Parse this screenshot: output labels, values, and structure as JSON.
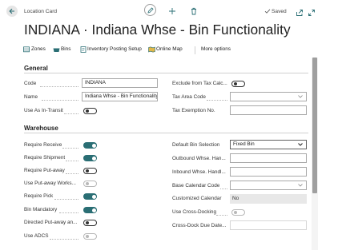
{
  "header": {
    "card_type": "Location Card",
    "saved": "Saved",
    "title": "INDIANA · Indiana Whse - Bin Functionality"
  },
  "actions": {
    "zones": "Zones",
    "bins": "Bins",
    "inventory_posting_setup": "Inventory Posting Setup",
    "online_map": "Online Map",
    "more_options": "More options"
  },
  "general": {
    "title": "General",
    "code_label": "Code",
    "code_value": "INDIANA",
    "name_label": "Name",
    "name_value": "Indiana Whse - Bin Functionality",
    "use_as_in_transit_label": "Use As In-Transit",
    "use_as_in_transit": false,
    "exclude_tax_label": "Exclude from Tax Calc...",
    "exclude_tax": false,
    "tax_area_code_label": "Tax Area Code",
    "tax_area_code_value": "",
    "tax_exemption_label": "Tax Exemption No.",
    "tax_exemption_value": ""
  },
  "warehouse": {
    "title": "Warehouse",
    "require_receive_label": "Require Receive",
    "require_receive": true,
    "require_shipment_label": "Require Shipment",
    "require_shipment": true,
    "require_putaway_label": "Require Put-away",
    "require_putaway": false,
    "use_putaway_worksheet_label": "Use Put-away Works...",
    "use_putaway_worksheet": false,
    "require_pick_label": "Require Pick",
    "require_pick": true,
    "bin_mandatory_label": "Bin Mandatory",
    "bin_mandatory": true,
    "directed_putaway_label": "Directed Put-away an...",
    "directed_putaway": false,
    "use_adcs_label": "Use ADCS",
    "use_adcs": false,
    "default_bin_selection_label": "Default Bin Selection",
    "default_bin_selection_value": "Fixed Bin",
    "outbound_whse_label": "Outbound Whse. Han...",
    "outbound_whse_value": "",
    "inbound_whse_label": "Inbound Whse. Handl...",
    "inbound_whse_value": "",
    "base_calendar_label": "Base Calendar Code",
    "base_calendar_value": "",
    "customized_calendar_label": "Customized Calendar",
    "customized_calendar_value": "No",
    "use_cross_docking_label": "Use Cross-Docking",
    "use_cross_docking": false,
    "cross_dock_due_date_label": "Cross-Dock Due Date...",
    "cross_dock_due_date_value": ""
  },
  "colors": {
    "accent": "#2a6e74",
    "toggle_on": "#2a6e74",
    "readonly_bg": "#e8e8e8"
  },
  "icons": [
    "back-arrow-icon",
    "edit-pencil-icon",
    "plus-icon",
    "trash-icon",
    "check-icon",
    "share-icon",
    "expand-icon",
    "zones-icon",
    "bins-icon",
    "posting-setup-icon",
    "map-icon",
    "chevron-down-icon"
  ]
}
